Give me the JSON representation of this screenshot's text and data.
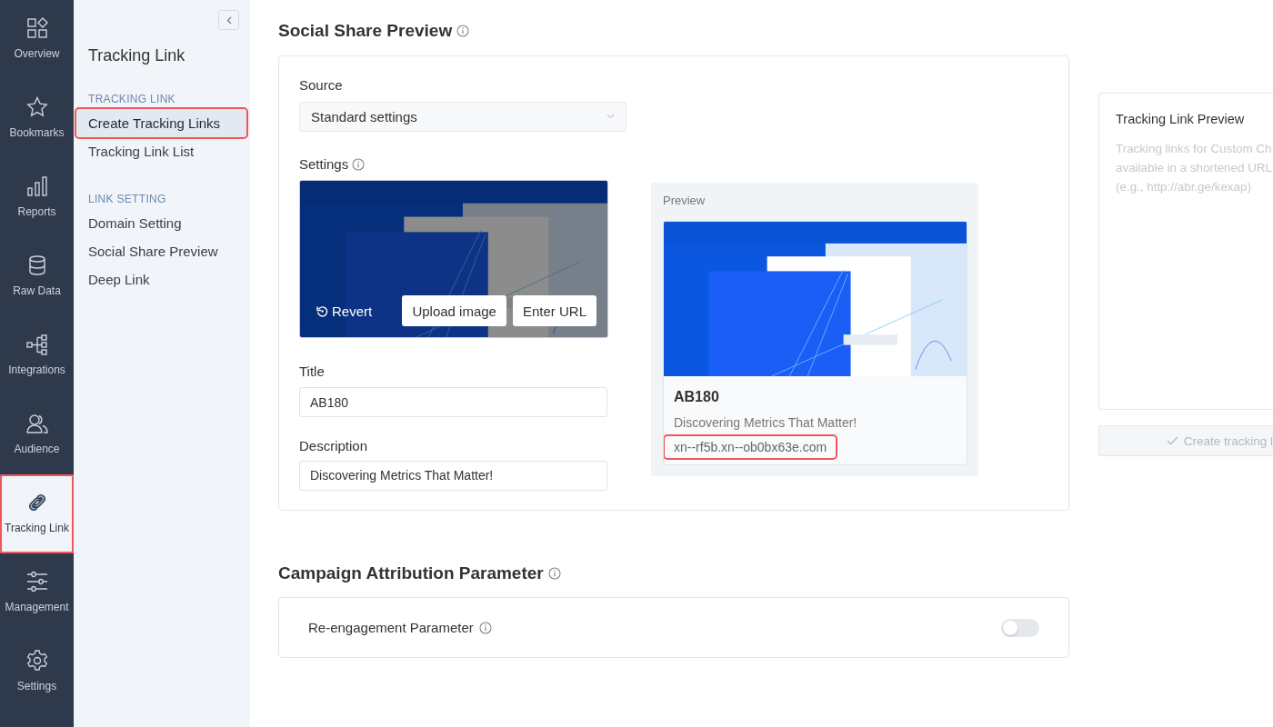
{
  "rail": {
    "items": [
      {
        "kind": "overview",
        "label": "Overview",
        "selected": false,
        "highlighted": false
      },
      {
        "kind": "bookmarks",
        "label": "Bookmarks",
        "selected": false,
        "highlighted": false
      },
      {
        "kind": "reports",
        "label": "Reports",
        "selected": false,
        "highlighted": false
      },
      {
        "kind": "database",
        "label": "Raw Data",
        "selected": false,
        "highlighted": false
      },
      {
        "kind": "integrations",
        "label": "Integrations",
        "selected": false,
        "highlighted": false
      },
      {
        "kind": "audience",
        "label": "Audience",
        "selected": false,
        "highlighted": false
      },
      {
        "kind": "link",
        "label": "Tracking Link",
        "selected": true,
        "highlighted": true
      },
      {
        "kind": "management",
        "label": "Management",
        "selected": false,
        "highlighted": false
      },
      {
        "kind": "settings",
        "label": "Settings",
        "selected": false,
        "highlighted": false
      }
    ]
  },
  "submenu": {
    "title": "Tracking Link",
    "sections": [
      {
        "heading": "TRACKING LINK",
        "items": [
          {
            "label": "Create Tracking Links",
            "selected": true,
            "highlighted": true
          },
          {
            "label": "Tracking Link List",
            "selected": false,
            "highlighted": false
          }
        ]
      },
      {
        "heading": "LINK SETTING",
        "items": [
          {
            "label": "Domain Setting",
            "selected": false,
            "highlighted": false
          },
          {
            "label": "Social Share Preview",
            "selected": false,
            "highlighted": false
          },
          {
            "label": "Deep Link",
            "selected": false,
            "highlighted": false
          }
        ]
      }
    ]
  },
  "social_share": {
    "title": "Social Share Preview",
    "source": {
      "label": "Source",
      "value": "Standard settings"
    },
    "settings": {
      "label": "Settings",
      "buttons": [
        {
          "kind": "revert",
          "label": "Revert"
        },
        {
          "kind": "plain",
          "label": "Upload image"
        },
        {
          "kind": "plain",
          "label": "Enter URL"
        }
      ]
    },
    "title_field": {
      "label": "Title",
      "value": "AB180"
    },
    "description_field": {
      "label": "Description",
      "value": "Discovering Metrics That Matter!"
    },
    "preview": {
      "label": "Preview",
      "title": "AB180",
      "description": "Discovering Metrics That Matter!",
      "url": "xn--rf5b.xn--ob0bx63e.com",
      "url_highlighted": true
    }
  },
  "campaign": {
    "title": "Campaign Attribution Parameter",
    "parameters": [
      {
        "label": "Re-engagement Parameter",
        "on": false
      }
    ]
  },
  "link_preview": {
    "title": "Tracking Link Preview",
    "hint_lines": [
      "Tracking links for Custom Ch",
      "available in a shortened URL",
      "(e.g., http://abr.ge/kexap)"
    ],
    "button": {
      "label": "Create tracking l",
      "disabled": true
    }
  }
}
